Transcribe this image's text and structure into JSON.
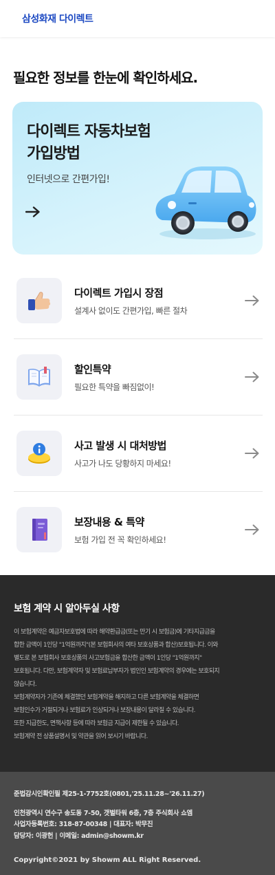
{
  "header": {
    "logo_text": "삼성화재 다이렉트"
  },
  "page_title": "필요한 정보를 한눈에 확인하세요.",
  "hero": {
    "title_line1": "다이렉트 자동차보험",
    "title_line2": "가입방법",
    "subtitle": "인터넷으로 간편가입!",
    "arrow_icon": "arrow-right-icon",
    "illustration": "blue-car-icon"
  },
  "menu": {
    "items": [
      {
        "title": "다이렉트 가입시 장점",
        "desc": "설계사 없이도 간편가입, 빠른 절차",
        "icon": "thumbs-up-icon"
      },
      {
        "title": "할인특약",
        "desc": "필요한 특약을 빠짐없이!",
        "icon": "open-book-icon"
      },
      {
        "title": "사고 발생 시 대처방법",
        "desc": "사고가 나도 당황하지 마세요!",
        "icon": "info-coin-icon"
      },
      {
        "title": "보장내용 & 특약",
        "desc": "보험 가입 전 꼭 확인하세요!",
        "icon": "purple-book-icon"
      }
    ]
  },
  "notice": {
    "title": "보험 계약 시 알아두실 사항",
    "lines": [
      "이 보험계약은 예금자보호법에 따라 해약환급금(또는 만기 시 보험금)에 기타지급금을",
      "합한 금액이 1인당 \"1억원까지\"(본 보험회사의 여타 보호상품과 합산)보호됩니다. 이와",
      "별도로 본 보험회사 보호상품의 사고보험금을 합산한 금액이 1인당 \"1억원까지\"",
      "보호됩니다. 다만, 보험계약자 및 보험료납부자가 법인인 보험계약의 경우에는 보호되지",
      "않습니다.",
      "보험계약자가 기존에 체결했던 보험계약을 해지하고 다른 보험계약을 체결하면",
      "보험인수가 거절되거나 보험료가 인상되거나 보장내용이 달라질 수 있습니다.",
      "또한 지급한도, 면책사항 등에 따라 보험금 지급이 제한될 수 있습니다.",
      "보험계약 전 상품설명서 및 약관을 읽어 보시기 바랍니다."
    ]
  },
  "footer": {
    "review_number": "준법감시인확인필 제25-1-7752호(0801,'25.11.28~'26.11.27)",
    "address": "인천광역시 연수구 송도동 7-50, 갯벌타워 6층, 7층 주식회사 쇼엠",
    "business_info": "사업자등록번호: 318-87-00348  |  대표자: 박무진",
    "contact": "담당자: 이광헌  |  이메일: admin@showm.kr",
    "copyright": "Copyright©2021 by Showm ALL Right Reserved."
  },
  "colors": {
    "brand": "#1c49c2",
    "hero_bg": "#c9eefb",
    "notice_bg": "#2a2a2a",
    "footer_bg": "#4a4a4a"
  }
}
